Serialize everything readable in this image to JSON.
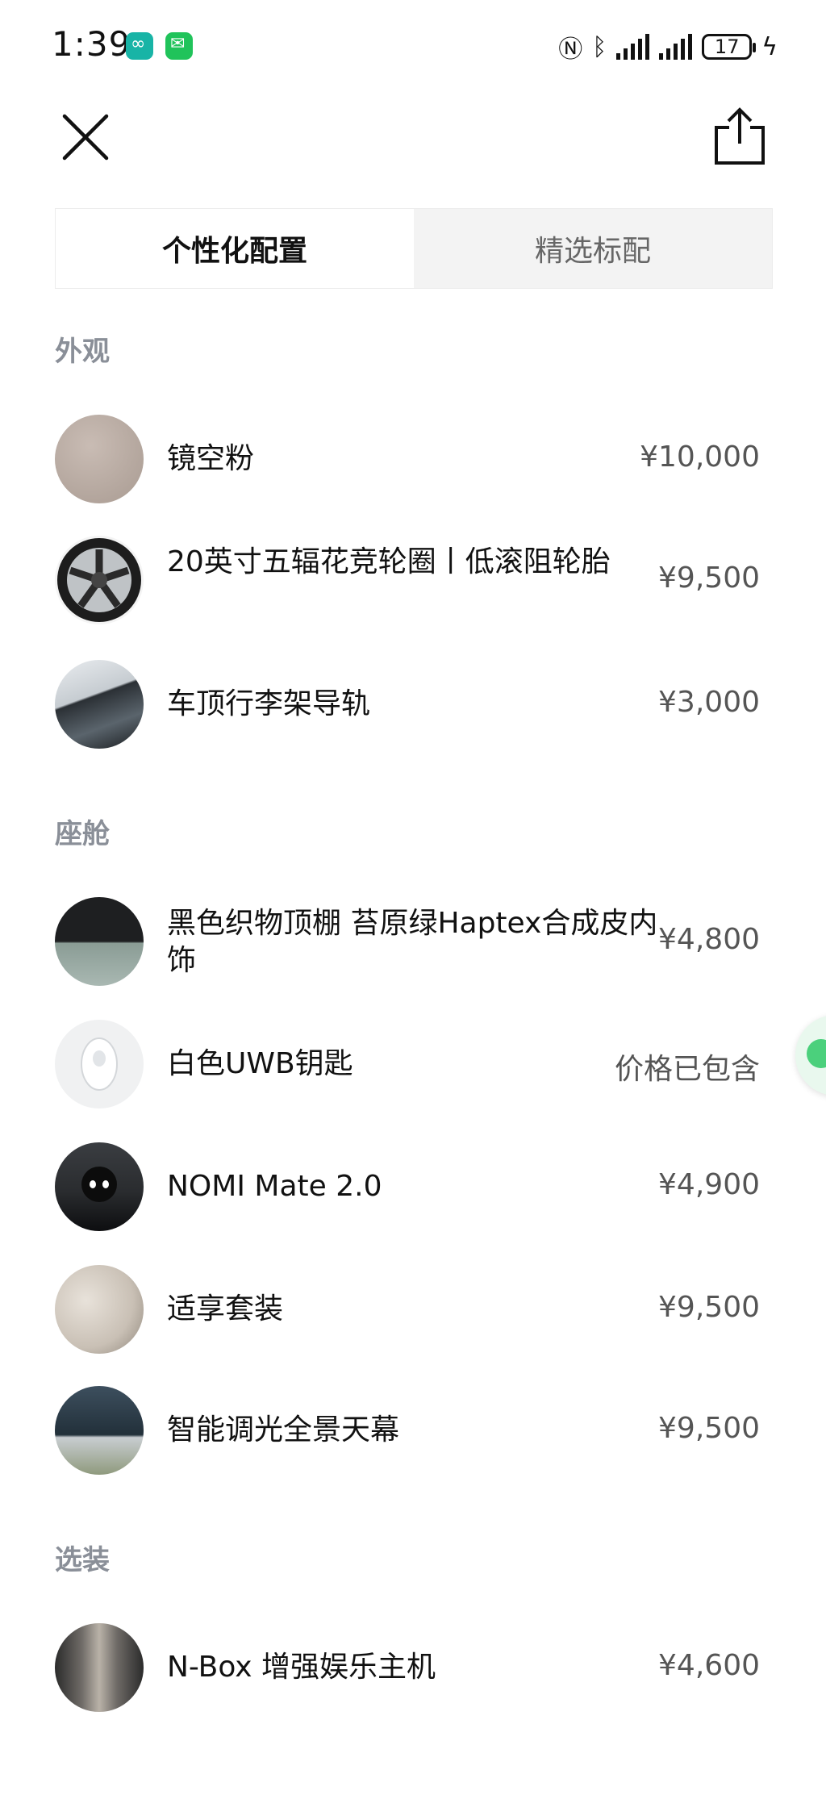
{
  "status_bar": {
    "time": "1:39",
    "battery": "17",
    "icons": [
      "nio-app-icon",
      "wechat-icon",
      "nfc-icon",
      "bluetooth-icon",
      "signal-icon",
      "signal-icon",
      "battery-icon",
      "charging-icon"
    ]
  },
  "header": {
    "close_icon": "close-icon",
    "share_icon": "share-icon"
  },
  "tabs": [
    {
      "label": "个性化配置",
      "active": true
    },
    {
      "label": "精选标配",
      "active": false
    }
  ],
  "sections": [
    {
      "title": "外观",
      "items": [
        {
          "name": "镜空粉",
          "price": "¥10,000"
        },
        {
          "name": "20英寸五辐花竞轮圈丨低滚阻轮胎",
          "price": "¥9,500"
        },
        {
          "name": "车顶行李架导轨",
          "price": "¥3,000"
        }
      ]
    },
    {
      "title": "座舱",
      "items": [
        {
          "name": "黑色织物顶棚 苔原绿Haptex合成皮内饰",
          "price": "¥4,800"
        },
        {
          "name": "白色UWB钥匙",
          "price": "价格已包含"
        },
        {
          "name": "NOMI Mate 2.0",
          "price": "¥4,900"
        },
        {
          "name": "适享套装",
          "price": "¥9,500"
        },
        {
          "name": "智能调光全景天幕",
          "price": "¥9,500"
        }
      ]
    },
    {
      "title": "选装",
      "items": [
        {
          "name": "N-Box 增强娱乐主机",
          "price": "¥4,600"
        }
      ]
    }
  ],
  "colors": {
    "section_title": "#8a8f98",
    "tab_inactive_bg": "#f3f3f3",
    "chat_bubble": "#4bd07c"
  }
}
